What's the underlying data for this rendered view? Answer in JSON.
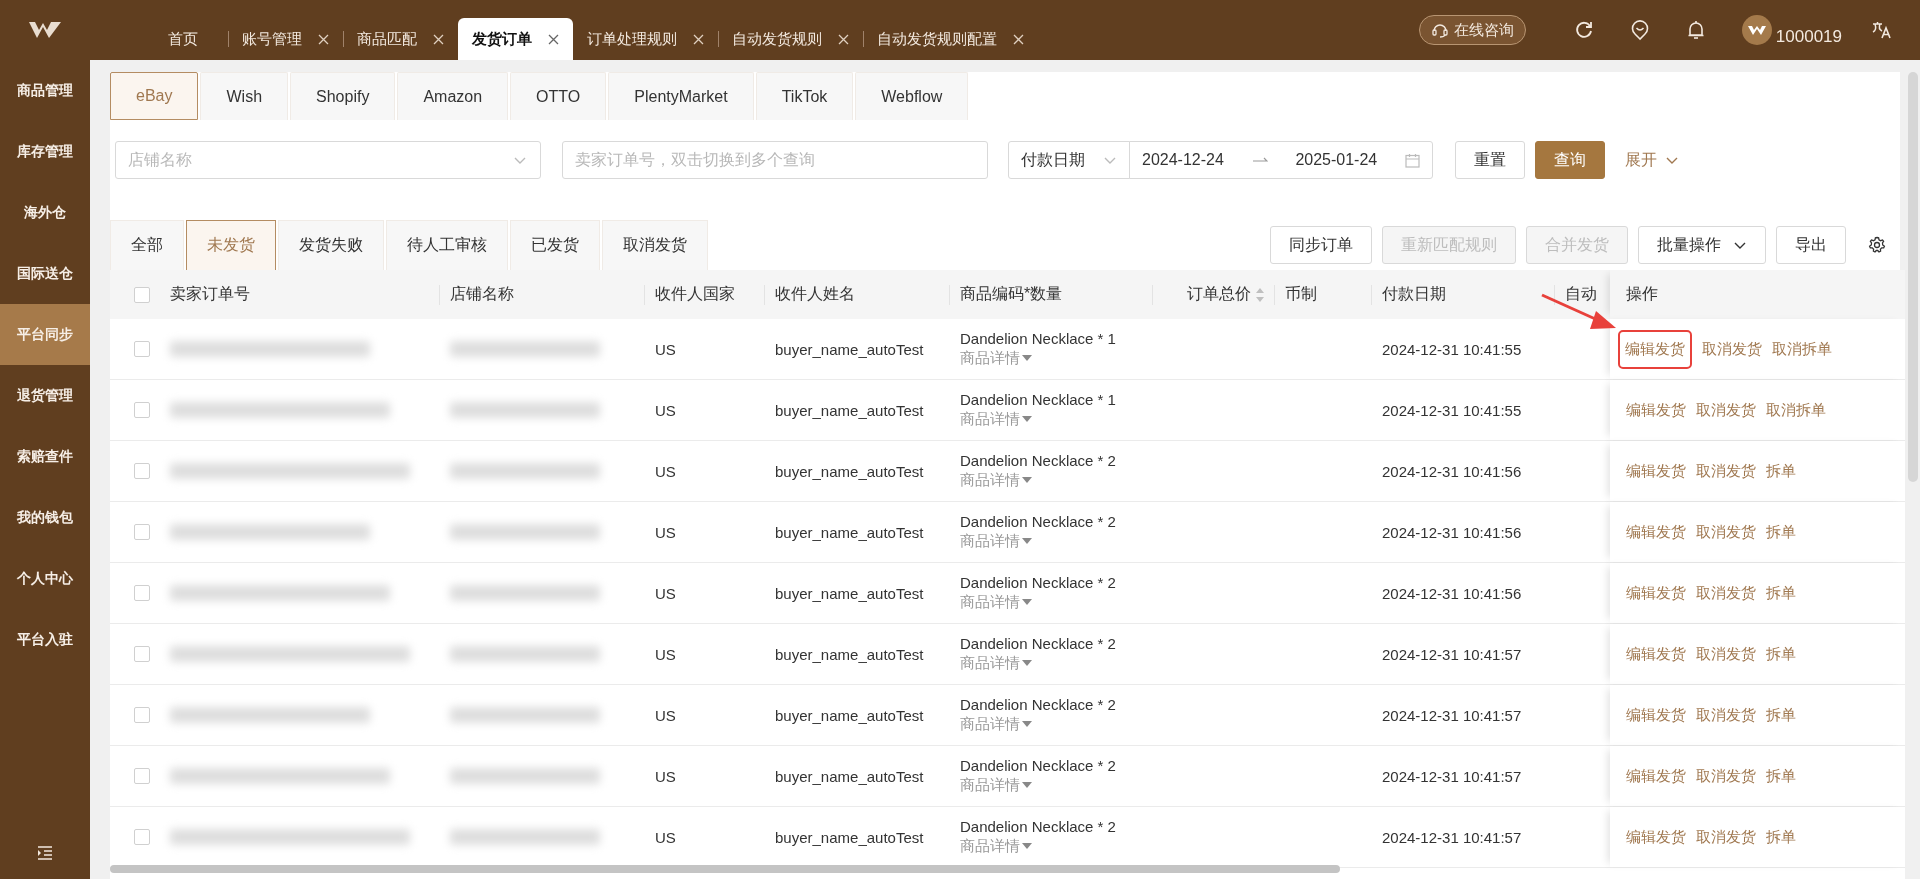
{
  "top_tabs": [
    {
      "label": "首页",
      "closable": false,
      "selected": false
    },
    {
      "label": "账号管理",
      "closable": true,
      "selected": false
    },
    {
      "label": "商品匹配",
      "closable": true,
      "selected": false
    },
    {
      "label": "发货订单",
      "closable": true,
      "selected": true
    },
    {
      "label": "订单处理规则",
      "closable": true,
      "selected": false
    },
    {
      "label": "自动发货规则",
      "closable": true,
      "selected": false
    },
    {
      "label": "自动发货规则配置",
      "closable": true,
      "selected": false
    }
  ],
  "header_actions": {
    "consult": "在线咨询",
    "user_id": "1000019"
  },
  "sidebar": {
    "items": [
      {
        "label": "商品管理",
        "selected": false
      },
      {
        "label": "库存管理",
        "selected": false
      },
      {
        "label": "海外仓",
        "selected": false
      },
      {
        "label": "国际送仓",
        "selected": false
      },
      {
        "label": "平台同步",
        "selected": true
      },
      {
        "label": "退货管理",
        "selected": false
      },
      {
        "label": "索赔查件",
        "selected": false
      },
      {
        "label": "我的钱包",
        "selected": false
      },
      {
        "label": "个人中心",
        "selected": false
      },
      {
        "label": "平台入驻",
        "selected": false
      }
    ]
  },
  "platform_tabs": [
    {
      "label": "eBay",
      "selected": true
    },
    {
      "label": "Wish",
      "selected": false
    },
    {
      "label": "Shopify",
      "selected": false
    },
    {
      "label": "Amazon",
      "selected": false
    },
    {
      "label": "OTTO",
      "selected": false
    },
    {
      "label": "PlentyMarket",
      "selected": false
    },
    {
      "label": "TikTok",
      "selected": false
    },
    {
      "label": "Webflow",
      "selected": false
    }
  ],
  "filters": {
    "shop": {
      "placeholder": "店铺名称"
    },
    "order_no": {
      "placeholder": "卖家订单号，双击切换到多个查询"
    },
    "date_type": "付款日期",
    "date_start": "2024-12-24",
    "date_end": "2025-01-24",
    "reset": "重置",
    "search": "查询",
    "expand": "展开"
  },
  "status_tabs": [
    {
      "label": "全部",
      "selected": false
    },
    {
      "label": "未发货",
      "selected": true
    },
    {
      "label": "发货失败",
      "selected": false
    },
    {
      "label": "待人工审核",
      "selected": false
    },
    {
      "label": "已发货",
      "selected": false
    },
    {
      "label": "取消发货",
      "selected": false
    }
  ],
  "toolbar": [
    {
      "label": "同步订单",
      "kind": "button",
      "disabled": false
    },
    {
      "label": "重新匹配规则",
      "kind": "button",
      "disabled": true
    },
    {
      "label": "合并发货",
      "kind": "button",
      "disabled": true
    },
    {
      "label": "批量操作",
      "kind": "dropdown",
      "disabled": false
    },
    {
      "label": "导出",
      "kind": "button",
      "disabled": false
    }
  ],
  "table": {
    "select_all_checked": false,
    "columns": [
      {
        "label": "卖家订单号",
        "sortable": false
      },
      {
        "label": "店铺名称",
        "sortable": false
      },
      {
        "label": "收件人国家",
        "sortable": false
      },
      {
        "label": "收件人姓名",
        "sortable": false
      },
      {
        "label": "商品编码*数量",
        "sortable": false
      },
      {
        "label": "订单总价",
        "sortable": true
      },
      {
        "label": "币制",
        "sortable": false
      },
      {
        "label": "付款日期",
        "sortable": false
      },
      {
        "label": "自动",
        "sortable": false
      },
      {
        "label": "操作",
        "sortable": false
      }
    ],
    "rows": [
      {
        "checked": false,
        "country": "US",
        "name": "buyer_name_autoTest",
        "product": "Dandelion Necklace * 1",
        "detail": "商品详情",
        "pay_date": "2024-12-31 10:41:55",
        "actions": [
          "编辑发货",
          "取消发货",
          "取消拆单"
        ],
        "highlighted": true
      },
      {
        "checked": false,
        "country": "US",
        "name": "buyer_name_autoTest",
        "product": "Dandelion Necklace * 1",
        "detail": "商品详情",
        "pay_date": "2024-12-31 10:41:55",
        "actions": [
          "编辑发货",
          "取消发货",
          "取消拆单"
        ],
        "highlighted": false
      },
      {
        "checked": false,
        "country": "US",
        "name": "buyer_name_autoTest",
        "product": "Dandelion Necklace * 2",
        "detail": "商品详情",
        "pay_date": "2024-12-31 10:41:56",
        "actions": [
          "编辑发货",
          "取消发货",
          "拆单"
        ],
        "highlighted": false
      },
      {
        "checked": false,
        "country": "US",
        "name": "buyer_name_autoTest",
        "product": "Dandelion Necklace * 2",
        "detail": "商品详情",
        "pay_date": "2024-12-31 10:41:56",
        "actions": [
          "编辑发货",
          "取消发货",
          "拆单"
        ],
        "highlighted": false
      },
      {
        "checked": false,
        "country": "US",
        "name": "buyer_name_autoTest",
        "product": "Dandelion Necklace * 2",
        "detail": "商品详情",
        "pay_date": "2024-12-31 10:41:56",
        "actions": [
          "编辑发货",
          "取消发货",
          "拆单"
        ],
        "highlighted": false
      },
      {
        "checked": false,
        "country": "US",
        "name": "buyer_name_autoTest",
        "product": "Dandelion Necklace * 2",
        "detail": "商品详情",
        "pay_date": "2024-12-31 10:41:57",
        "actions": [
          "编辑发货",
          "取消发货",
          "拆单"
        ],
        "highlighted": false
      },
      {
        "checked": false,
        "country": "US",
        "name": "buyer_name_autoTest",
        "product": "Dandelion Necklace * 2",
        "detail": "商品详情",
        "pay_date": "2024-12-31 10:41:57",
        "actions": [
          "编辑发货",
          "取消发货",
          "拆单"
        ],
        "highlighted": false
      },
      {
        "checked": false,
        "country": "US",
        "name": "buyer_name_autoTest",
        "product": "Dandelion Necklace * 2",
        "detail": "商品详情",
        "pay_date": "2024-12-31 10:41:57",
        "actions": [
          "编辑发货",
          "取消发货",
          "拆单"
        ],
        "highlighted": false
      },
      {
        "checked": false,
        "country": "US",
        "name": "buyer_name_autoTest",
        "product": "Dandelion Necklace * 2",
        "detail": "商品详情",
        "pay_date": "2024-12-31 10:41:57",
        "actions": [
          "编辑发货",
          "取消发货",
          "拆单"
        ],
        "highlighted": false
      }
    ]
  }
}
